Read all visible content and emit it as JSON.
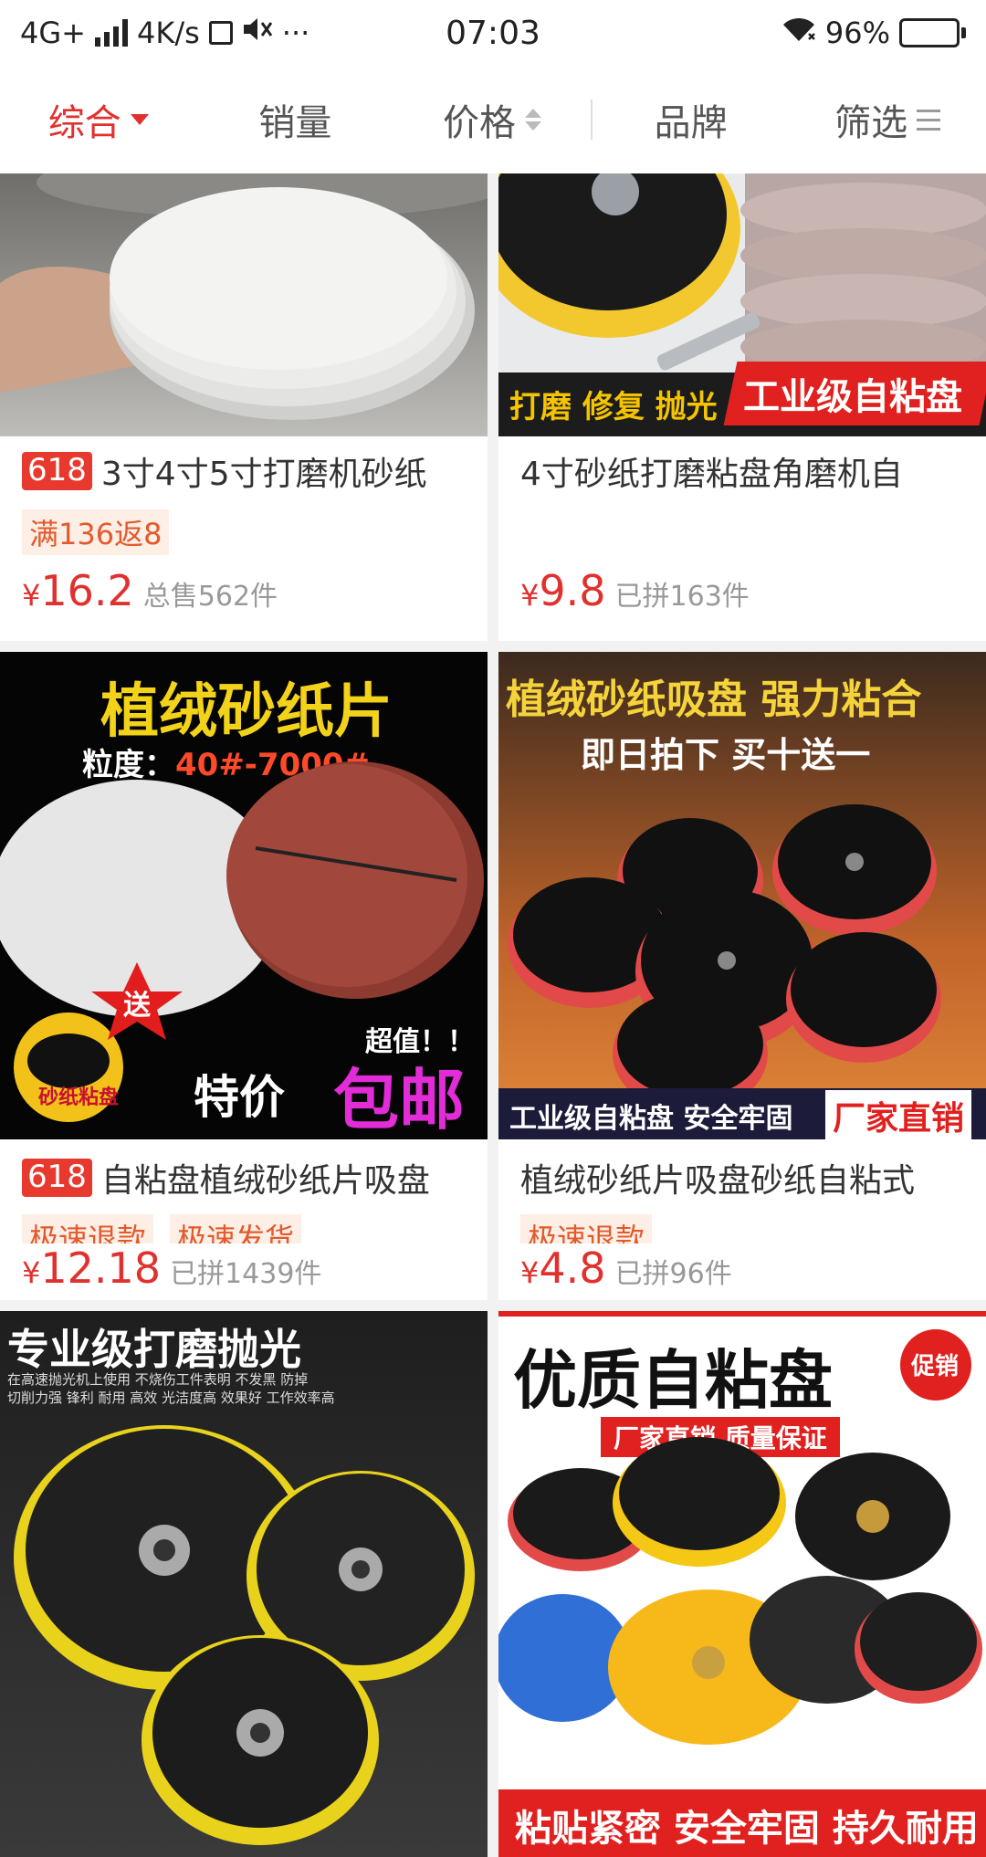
{
  "status_bar": {
    "network": "4G+",
    "speed": "4K/s",
    "time": "07:03",
    "battery": "96%",
    "battery_level": 0.96,
    "dots": "···"
  },
  "filters": [
    {
      "label": "综合",
      "active": true
    },
    {
      "label": "销量"
    },
    {
      "label": "价格"
    },
    {
      "label": "品牌"
    },
    {
      "label": "筛选"
    }
  ],
  "products": [
    {
      "tag": "618",
      "title": "3寸4寸5寸打磨机砂纸",
      "promos": [
        "满136返8"
      ],
      "currency": "¥",
      "price": "16.2",
      "sold": "总售562件"
    },
    {
      "title": "4寸砂纸打磨粘盘角磨机自",
      "promos": [],
      "currency": "¥",
      "price": "9.8",
      "sold": "已拼163件",
      "image_banner_left": "打磨 修复 抛光",
      "image_banner_right": "工业级自粘盘"
    },
    {
      "tag": "618",
      "title": "自粘盘植绒砂纸片吸盘",
      "promos": [
        "极速退款",
        "极速发货"
      ],
      "currency": "¥",
      "price": "12.18",
      "sold": "已拼1439件",
      "image_headline": "植绒砂纸片",
      "image_grit_label": "粒度：",
      "image_grit_value": "40#-7000#",
      "image_gift": "送",
      "image_gift_item": "砂纸粘盘",
      "image_deal": "超值！！",
      "image_special": "特价",
      "image_free_ship": "包邮"
    },
    {
      "title": "植绒砂纸片吸盘砂纸自粘式",
      "promos": [
        "极速退款"
      ],
      "currency": "¥",
      "price": "4.8",
      "sold": "已拼96件",
      "image_headline": "植绒砂纸吸盘 强力粘合",
      "image_sub": "即日拍下 买十送一",
      "image_banner_left": "工业级自粘盘 安全牢固",
      "image_banner_right": "厂家直销"
    },
    {
      "image_headline": "专业级打磨抛光",
      "image_desc1": "在高速抛光机上使用 不烧伤工件表明 不发黑 防掉",
      "image_desc2": "切削力强 锋利 耐用 高效 光洁度高 效果好 工作效率高"
    },
    {
      "image_headline": "优质自粘盘",
      "image_badge": "促销",
      "image_sub": "厂家直销 质量保证",
      "image_footer": "粘贴紧密 安全牢固 持久耐用"
    }
  ]
}
